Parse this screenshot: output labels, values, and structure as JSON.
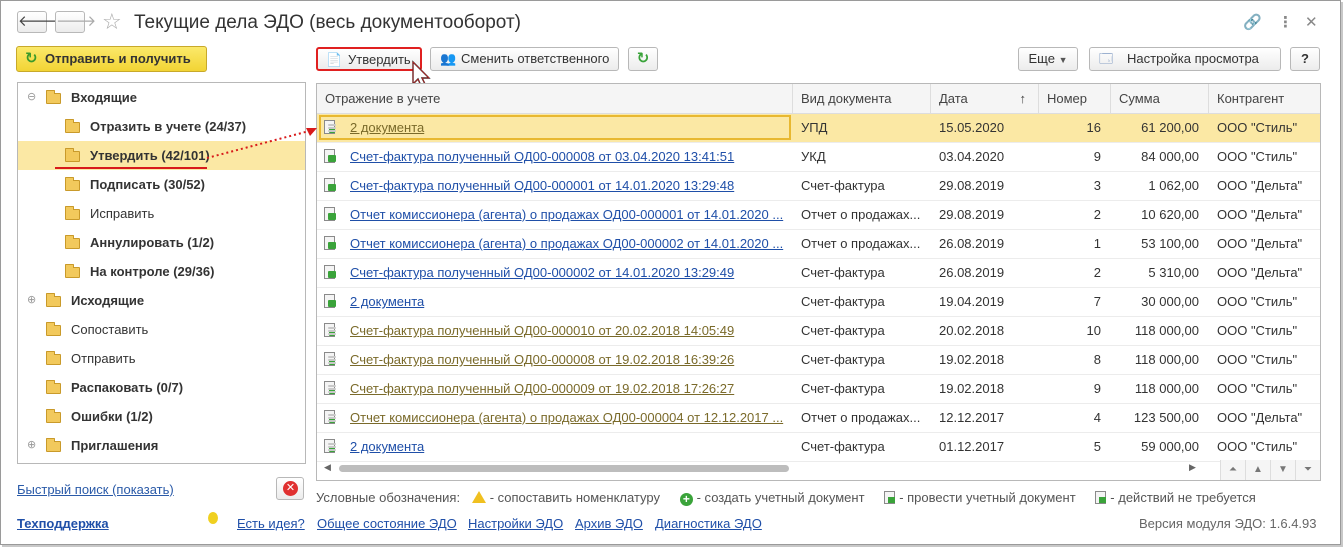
{
  "window": {
    "title": "Текущие дела ЭДО (весь документооборот)"
  },
  "left": {
    "send_button": "Отправить и получить",
    "tree": [
      {
        "label": "Входящие",
        "bold": true,
        "level": 0,
        "expander": "⊖",
        "selected": false
      },
      {
        "label": "Отразить в учете (24/37)",
        "bold": true,
        "level": 1,
        "selected": false
      },
      {
        "label": "Утвердить (42/101)",
        "bold": true,
        "level": 1,
        "selected": true
      },
      {
        "label": "Подписать (30/52)",
        "bold": true,
        "level": 1,
        "selected": false
      },
      {
        "label": "Исправить",
        "bold": false,
        "level": 1,
        "selected": false
      },
      {
        "label": "Аннулировать (1/2)",
        "bold": true,
        "level": 1,
        "selected": false
      },
      {
        "label": "На контроле (29/36)",
        "bold": true,
        "level": 1,
        "selected": false
      },
      {
        "label": "Исходящие",
        "bold": true,
        "level": 0,
        "expander": "⊕",
        "selected": false
      },
      {
        "label": "Сопоставить",
        "bold": false,
        "level": 0,
        "selected": false
      },
      {
        "label": "Отправить",
        "bold": false,
        "level": 0,
        "selected": false
      },
      {
        "label": "Распаковать (0/7)",
        "bold": true,
        "level": 0,
        "selected": false
      },
      {
        "label": "Ошибки (1/2)",
        "bold": true,
        "level": 0,
        "selected": false
      },
      {
        "label": "Приглашения",
        "bold": true,
        "level": 0,
        "expander": "⊕",
        "selected": false
      }
    ],
    "quick_search": "Быстрый поиск (показать)"
  },
  "toolbar": {
    "approve": "Утвердить",
    "change_responsible": "Сменить ответственного",
    "more": "Еще",
    "view_settings": "Настройка просмотра",
    "help": "?"
  },
  "grid": {
    "columns": [
      "Отражение в учете",
      "Вид документа",
      "Дата",
      "Номер",
      "Сумма",
      "Контрагент"
    ],
    "sort_indicator": "↑",
    "rows": [
      {
        "doc": "2 документа",
        "kind": "УПД",
        "date": "15.05.2020",
        "num": "16",
        "sum": "61 200,00",
        "party": "ООО \"Стиль\"",
        "style": "olive",
        "icon": "list",
        "selected": true
      },
      {
        "doc": "Счет-фактура полученный ОД00-000008 от 03.04.2020 13:41:51",
        "kind": "УКД",
        "date": "03.04.2020",
        "num": "9",
        "sum": "84 000,00",
        "party": "ООО \"Стиль\"",
        "style": "blue",
        "icon": "doc",
        "selected": false
      },
      {
        "doc": "Счет-фактура полученный ОД00-000001 от 14.01.2020 13:29:48",
        "kind": "Счет-фактура",
        "date": "29.08.2019",
        "num": "3",
        "sum": "1 062,00",
        "party": "ООО \"Дельта\"",
        "style": "blue",
        "icon": "doc",
        "selected": false
      },
      {
        "doc": "Отчет комиссионера (агента) о продажах ОД00-000001 от 14.01.2020 ...",
        "kind": "Отчет о продажах...",
        "date": "29.08.2019",
        "num": "2",
        "sum": "10 620,00",
        "party": "ООО \"Дельта\"",
        "style": "blue",
        "icon": "doc",
        "selected": false
      },
      {
        "doc": "Отчет комиссионера (агента) о продажах ОД00-000002 от 14.01.2020 ...",
        "kind": "Отчет о продажах...",
        "date": "26.08.2019",
        "num": "1",
        "sum": "53 100,00",
        "party": "ООО \"Дельта\"",
        "style": "blue",
        "icon": "doc",
        "selected": false
      },
      {
        "doc": "Счет-фактура полученный ОД00-000002 от 14.01.2020 13:29:49",
        "kind": "Счет-фактура",
        "date": "26.08.2019",
        "num": "2",
        "sum": "5 310,00",
        "party": "ООО \"Дельта\"",
        "style": "blue",
        "icon": "doc",
        "selected": false
      },
      {
        "doc": "2 документа",
        "kind": "Счет-фактура",
        "date": "19.04.2019",
        "num": "7",
        "sum": "30 000,00",
        "party": "ООО \"Стиль\"",
        "style": "blue",
        "icon": "doc",
        "selected": false
      },
      {
        "doc": "Счет-фактура полученный ОД00-000010 от 20.02.2018 14:05:49",
        "kind": "Счет-фактура",
        "date": "20.02.2018",
        "num": "10",
        "sum": "118 000,00",
        "party": "ООО \"Стиль\"",
        "style": "olive",
        "icon": "list",
        "selected": false
      },
      {
        "doc": "Счет-фактура полученный ОД00-000008 от 19.02.2018 16:39:26",
        "kind": "Счет-фактура",
        "date": "19.02.2018",
        "num": "8",
        "sum": "118 000,00",
        "party": "ООО \"Стиль\"",
        "style": "olive",
        "icon": "list",
        "selected": false
      },
      {
        "doc": "Счет-фактура полученный ОД00-000009 от 19.02.2018 17:26:27",
        "kind": "Счет-фактура",
        "date": "19.02.2018",
        "num": "9",
        "sum": "118 000,00",
        "party": "ООО \"Стиль\"",
        "style": "olive",
        "icon": "list",
        "selected": false
      },
      {
        "doc": "Отчет комиссионера (агента) о продажах ОД00-000004 от 12.12.2017 ...",
        "kind": "Отчет о продажах...",
        "date": "12.12.2017",
        "num": "4",
        "sum": "123 500,00",
        "party": "ООО \"Дельта\"",
        "style": "olive",
        "icon": "list",
        "selected": false
      },
      {
        "doc": "2 документа",
        "kind": "Счет-фактура",
        "date": "01.12.2017",
        "num": "5",
        "sum": "59 000,00",
        "party": "ООО \"Стиль\"",
        "style": "blue",
        "icon": "list",
        "selected": false
      }
    ]
  },
  "legend": {
    "title": "Условные обозначения:",
    "items": [
      "- сопоставить номенклатуру",
      "- создать учетный документ",
      "- провести учетный документ",
      "- действий не требуется"
    ]
  },
  "footer": {
    "support": "Техподдержка",
    "idea": "Есть идея?",
    "status": "Общее состояние ЭДО",
    "settings": "Настройки ЭДО",
    "archive": "Архив ЭДО",
    "diagnostics": "Диагностика ЭДО",
    "version": "Версия модуля ЭДО: 1.6.4.93"
  },
  "colors": {
    "accent_yellow": "#f2d434",
    "selection": "#fbe8a4",
    "link_blue": "#1f4fa8",
    "link_olive": "#7a6a2a",
    "highlight_red": "#e02020"
  }
}
